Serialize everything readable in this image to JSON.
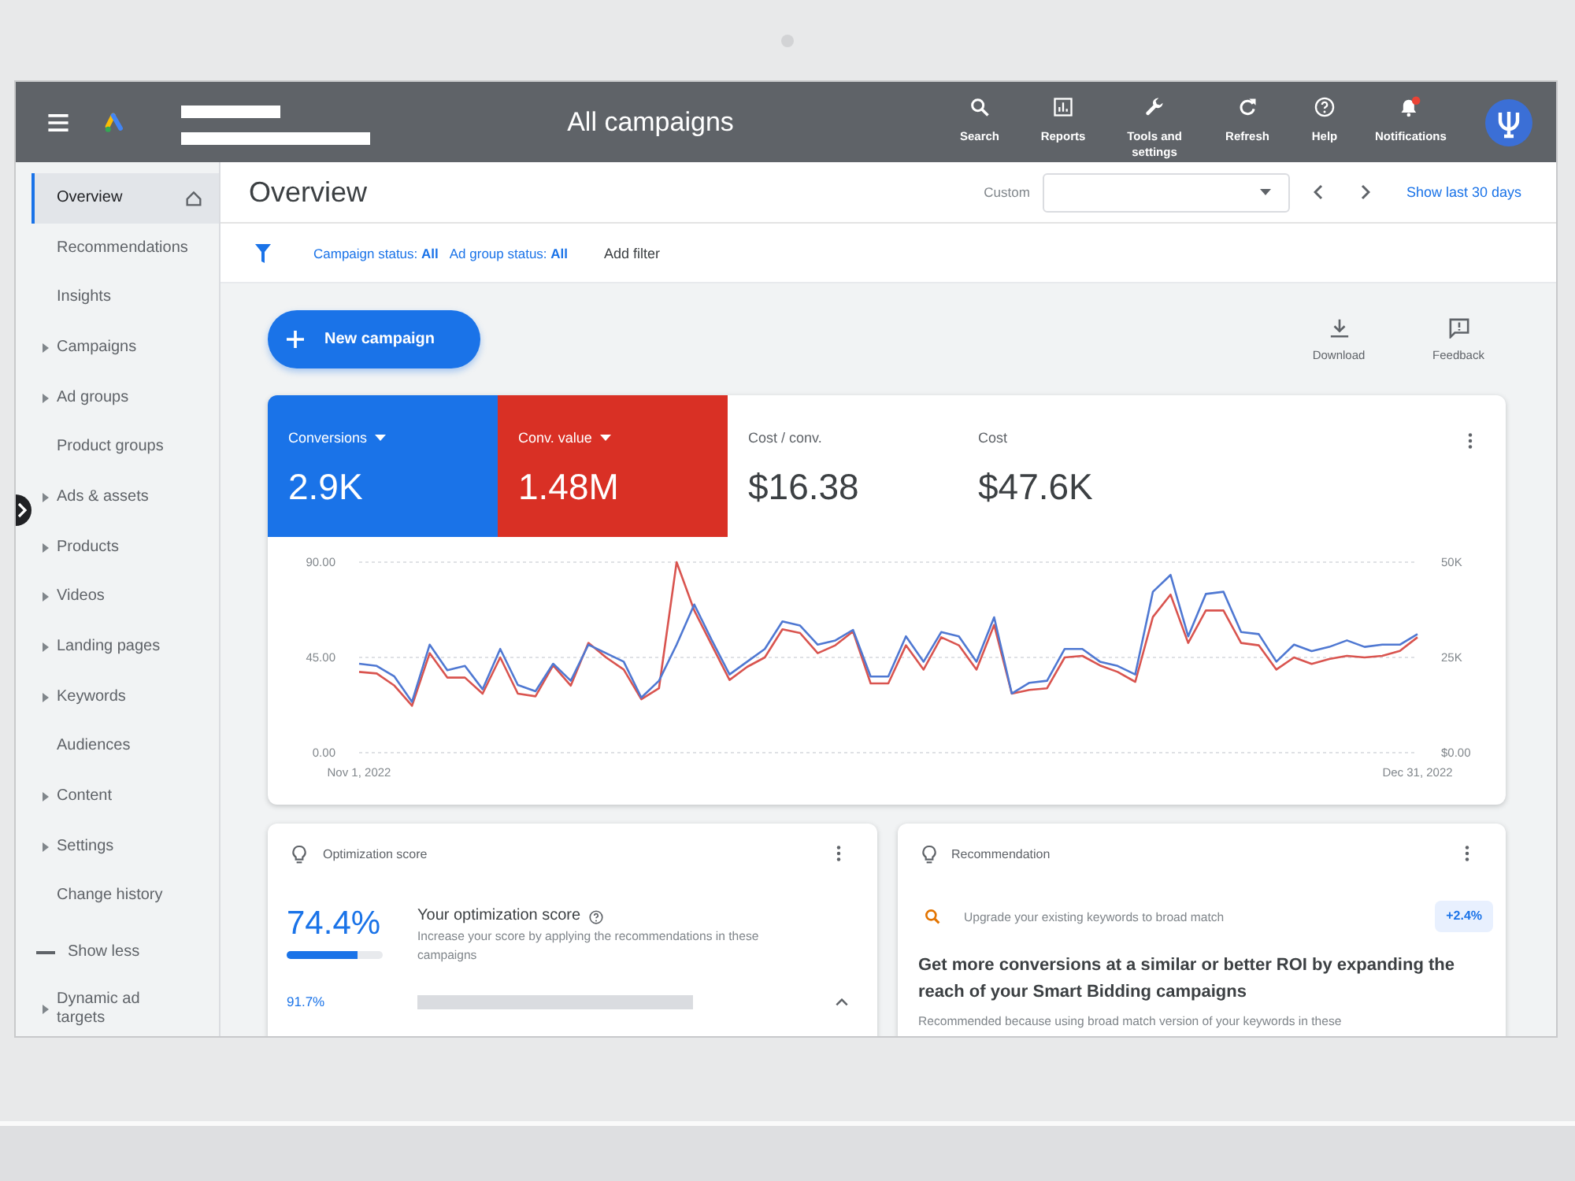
{
  "top_bar": {
    "title": "All campaigns",
    "actions": [
      {
        "label": "Search",
        "kind": "search"
      },
      {
        "label": "Reports",
        "kind": "reports"
      },
      {
        "label": "Tools and settings",
        "kind": "tools"
      },
      {
        "label": "Refresh",
        "kind": "refresh"
      },
      {
        "label": "Help",
        "kind": "help"
      },
      {
        "label": "Notifications",
        "kind": "notifications"
      }
    ]
  },
  "sidebar": {
    "items": [
      {
        "label": "Overview",
        "kind": "home",
        "selected": true
      },
      {
        "label": "Recommendations",
        "kind": "page",
        "selected": false
      },
      {
        "label": "Insights",
        "kind": "page",
        "selected": false
      },
      {
        "label": "Campaigns",
        "kind": "group",
        "selected": false
      },
      {
        "label": "Ad groups",
        "kind": "group",
        "selected": false
      },
      {
        "label": "Product groups",
        "kind": "page",
        "selected": false
      },
      {
        "label": "Ads & assets",
        "kind": "group",
        "selected": false
      },
      {
        "label": "Products",
        "kind": "group",
        "selected": false
      },
      {
        "label": "Videos",
        "kind": "group",
        "selected": false
      },
      {
        "label": "Landing pages",
        "kind": "group",
        "selected": false
      },
      {
        "label": "Keywords",
        "kind": "group",
        "selected": false
      },
      {
        "label": "Audiences",
        "kind": "page",
        "selected": false
      },
      {
        "label": "Content",
        "kind": "group",
        "selected": false
      },
      {
        "label": "Settings",
        "kind": "group",
        "selected": false
      },
      {
        "label": "Change history",
        "kind": "page",
        "selected": false
      },
      {
        "label": "Show less",
        "kind": "toggle",
        "selected": false
      },
      {
        "label": "Dynamic ad targets",
        "kind": "group",
        "selected": false
      }
    ]
  },
  "header": {
    "title": "Overview",
    "date_label": "Custom",
    "date_range_link": "Show last 30 days"
  },
  "filters": {
    "chips": [
      "Campaign status: **All**",
      "Ad group status: **All**"
    ],
    "add_filter": "Add filter"
  },
  "toolbar": {
    "new_campaign": "New campaign",
    "actions": [
      {
        "label": "Download",
        "kind": "download"
      },
      {
        "label": "Feedback",
        "kind": "feedback"
      }
    ]
  },
  "performance_card": {
    "metrics": [
      {
        "label": "Conversions",
        "value": "2.9K",
        "selected": true,
        "color": "#1a73e8"
      },
      {
        "label": "Conv. value",
        "value": "1.48M",
        "selected": true,
        "color": "#d93025"
      },
      {
        "label": "Cost / conv.",
        "value": "$16.38",
        "selected": false
      },
      {
        "label": "Cost",
        "value": "$47.6K",
        "selected": false
      }
    ],
    "chart_data": [
      {
        "type": "line",
        "grid": true,
        "categories": [
          "Nov 1, 2022",
          null,
          null,
          null,
          null,
          null,
          null,
          null,
          null,
          null,
          null,
          null,
          null,
          null,
          null,
          null,
          null,
          null,
          null,
          null,
          null,
          null,
          null,
          null,
          null,
          null,
          null,
          null,
          null,
          null,
          null,
          null,
          null,
          null,
          null,
          null,
          null,
          null,
          null,
          null,
          null,
          null,
          null,
          null,
          null,
          null,
          null,
          null,
          null,
          null,
          null,
          null,
          null,
          null,
          null,
          null,
          null,
          null,
          null,
          null,
          "Dec 31, 2022"
        ],
        "ylim": [
          0,
          90
        ],
        "y2lim": [
          0,
          50000
        ],
        "yticks": [
          {
            "value": 0,
            "label": "0.00"
          },
          {
            "value": 45,
            "label": "45.00"
          },
          {
            "value": 90,
            "label": "90.00"
          }
        ],
        "y2ticks": [
          {
            "value": 0,
            "label": "$0.00"
          },
          {
            "value": 25000,
            "label": "25K"
          },
          {
            "value": 50000,
            "label": "50K"
          }
        ],
        "series": [
          {
            "color": "#d9544f",
            "axis": "y2",
            "values": [
              21200,
              20800,
              17600,
              12300,
              26100,
              19700,
              19700,
              15500,
              25000,
              15500,
              14800,
              22900,
              17600,
              28800,
              25000,
              21800,
              14000,
              16900,
              50000,
              37300,
              28200,
              19100,
              22500,
              25000,
              32400,
              31400,
              26100,
              28200,
              31800,
              18200,
              18200,
              28200,
              21800,
              30300,
              28200,
              21800,
              33500,
              15500,
              16500,
              16900,
              25000,
              25400,
              22900,
              21200,
              18600,
              35600,
              41500,
              28800,
              37300,
              37300,
              28800,
              28200,
              21800,
              25000,
              23300,
              24600,
              25400,
              25000,
              25400,
              26700,
              30300
            ]
          },
          {
            "color": "#4f78d2",
            "values": [
              42,
              41,
              36,
              24,
              51,
              39,
              41,
              30,
              49,
              32,
              29,
              42,
              34,
              51,
              47,
              43,
              26,
              34,
              51,
              70,
              53,
              37,
              43,
              49,
              62,
              60,
              51,
              53,
              58,
              36,
              36,
              55,
              43,
              57,
              55,
              43,
              64,
              28,
              33,
              34,
              49,
              49,
              43,
              41,
              37,
              76,
              84,
              55,
              75,
              76,
              57,
              56,
              43,
              51,
              48,
              50,
              53,
              50,
              51,
              51,
              56
            ]
          }
        ]
      }
    ]
  },
  "optimization_card": {
    "title": "Optimization score",
    "score": "74.4%",
    "level": 0.744,
    "heading": "Your optimization score",
    "description": "Increase your score by applying the recommendations in these campaigns",
    "campaign_score": "91.7%"
  },
  "recommendation_card": {
    "title": "Recommendation",
    "suggestion": "Upgrade your existing keywords to broad match",
    "badge": "+2.4%",
    "headline": "Get more conversions at a similar or better ROI by expanding the reach of your Smart Bidding campaigns",
    "reason": "Recommended because using broad match version of your keywords in these"
  }
}
